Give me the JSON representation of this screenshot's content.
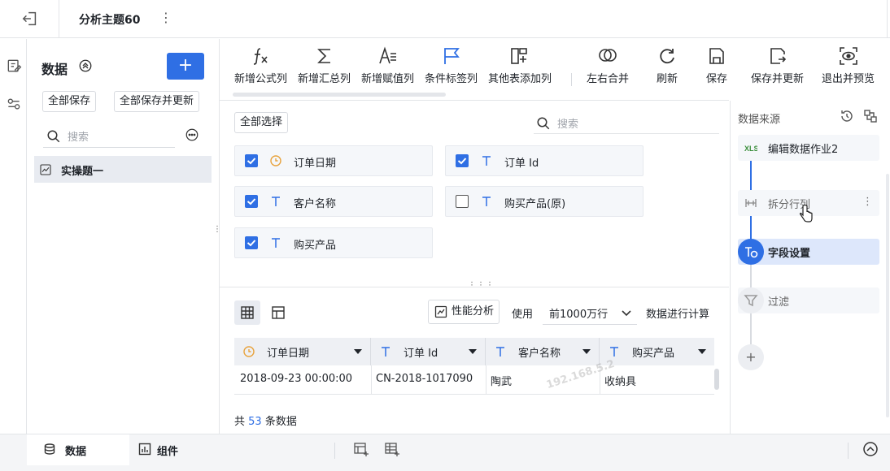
{
  "header": {
    "title": "分析主题60"
  },
  "left_panel": {
    "title": "数据",
    "save_all": "全部保存",
    "save_all_update": "全部保存并更新",
    "search_placeholder": "搜索",
    "items": [
      {
        "label": "实操题一"
      }
    ]
  },
  "toolbar": {
    "buttons": [
      {
        "label": "新增公式列",
        "icon": "formula-icon"
      },
      {
        "label": "新增汇总列",
        "icon": "sigma-icon"
      },
      {
        "label": "新增赋值列",
        "icon": "assign-icon"
      },
      {
        "label": "条件标签列",
        "icon": "flag-icon"
      },
      {
        "label": "其他表添加列",
        "icon": "add-column-icon"
      },
      {
        "label": "左右合并",
        "icon": "merge-icon"
      },
      {
        "label": "刷新",
        "icon": "refresh-icon"
      },
      {
        "label": "保存",
        "icon": "save-icon"
      },
      {
        "label": "保存并更新",
        "icon": "save-update-icon"
      },
      {
        "label": "退出并预览",
        "icon": "exit-preview-icon"
      }
    ]
  },
  "fields": {
    "select_all": "全部选择",
    "search_placeholder": "搜索",
    "items": [
      {
        "label": "订单日期",
        "type": "date",
        "checked": true
      },
      {
        "label": "订单 Id",
        "type": "text",
        "checked": true
      },
      {
        "label": "客户名称",
        "type": "text",
        "checked": true
      },
      {
        "label": "购买产品(原)",
        "type": "text",
        "checked": false
      },
      {
        "label": "购买产品",
        "type": "text",
        "checked": true
      }
    ]
  },
  "preview": {
    "perf_label": "性能分析",
    "use_label": "使用",
    "rows_option": "前1000万行",
    "calc_label": "数据进行计算",
    "columns": [
      "订单日期",
      "订单 Id",
      "客户名称",
      "购买产品"
    ],
    "rows": [
      [
        "2018-09-23 00:00:00",
        "CN-2018-1017090",
        "陶武",
        "收纳具"
      ]
    ],
    "watermark": "192.168.5.2",
    "total_prefix": "共",
    "total_count": "53",
    "total_suffix": "条数据"
  },
  "source_panel": {
    "title": "数据来源",
    "nodes": [
      {
        "label": "编辑数据作业2",
        "icon": "xls-icon"
      },
      {
        "label": "拆分行列",
        "icon": "split-icon"
      },
      {
        "label": "字段设置",
        "icon": "field-setting-icon"
      },
      {
        "label": "过滤",
        "icon": "filter-icon"
      }
    ],
    "add_label": "+"
  },
  "bottom_tabs": {
    "data": "数据",
    "component": "组件"
  },
  "colors": {
    "accent": "#2f6fe4",
    "date_icon": "#e8a33d"
  }
}
